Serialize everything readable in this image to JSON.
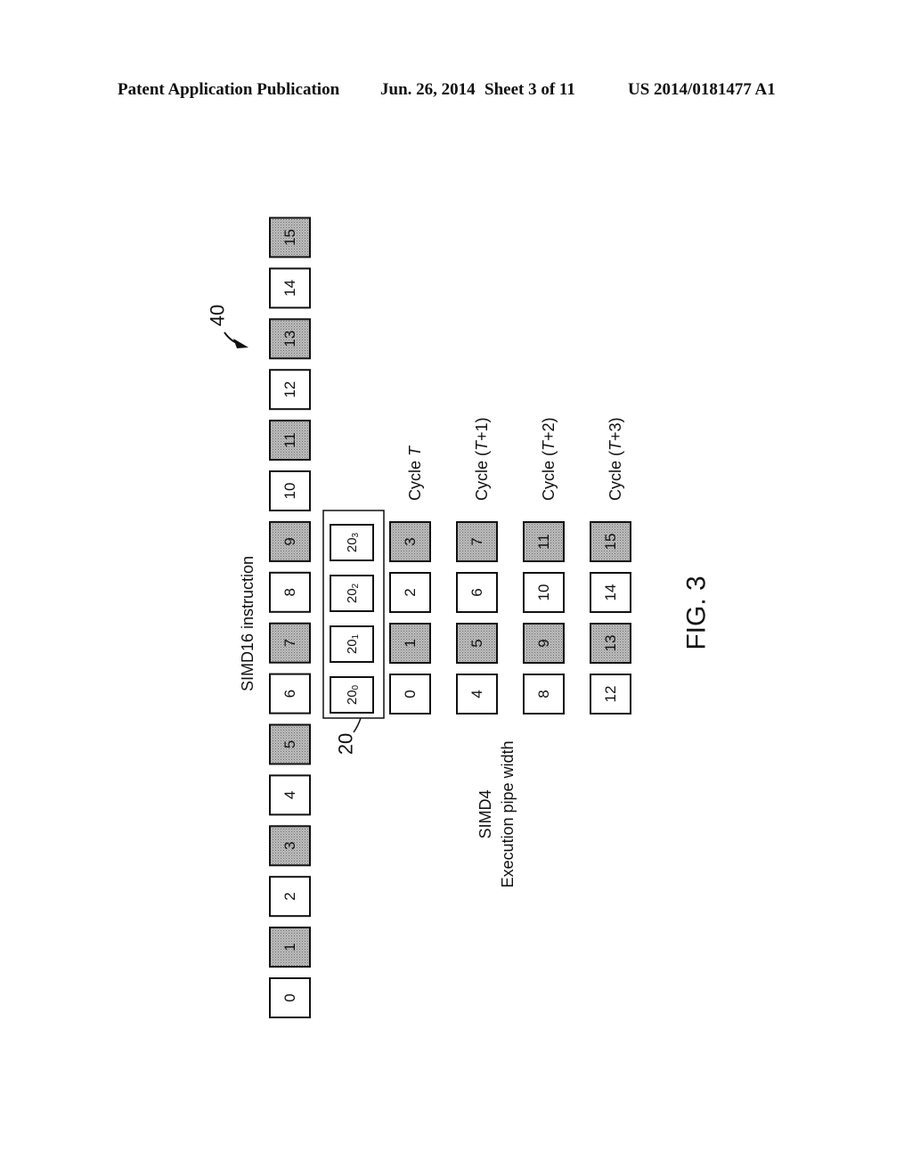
{
  "header": {
    "left": "Patent Application Publication",
    "date": "Jun. 26, 2014",
    "sheet": "Sheet 3 of 11",
    "number": "US 2014/0181477 A1"
  },
  "figure": {
    "caption": "FIG. 3",
    "simd16_label": "SIMD16 instruction",
    "ref_40": "40",
    "ref_20": "20",
    "simd4_label_line1": "SIMD4",
    "simd4_label_line2": "Execution pipe width",
    "simd16_lanes": [
      {
        "label": "0",
        "shaded": false
      },
      {
        "label": "1",
        "shaded": true
      },
      {
        "label": "2",
        "shaded": false
      },
      {
        "label": "3",
        "shaded": true
      },
      {
        "label": "4",
        "shaded": false
      },
      {
        "label": "5",
        "shaded": true
      },
      {
        "label": "6",
        "shaded": false
      },
      {
        "label": "7",
        "shaded": true
      },
      {
        "label": "8",
        "shaded": false
      },
      {
        "label": "9",
        "shaded": true
      },
      {
        "label": "10",
        "shaded": false
      },
      {
        "label": "11",
        "shaded": true
      },
      {
        "label": "12",
        "shaded": false
      },
      {
        "label": "13",
        "shaded": true
      },
      {
        "label": "14",
        "shaded": false
      },
      {
        "label": "15",
        "shaded": true
      }
    ],
    "pipes": [
      {
        "base": "20",
        "sub": "0"
      },
      {
        "base": "20",
        "sub": "1"
      },
      {
        "base": "20",
        "sub": "2"
      },
      {
        "base": "20",
        "sub": "3"
      }
    ],
    "cycles": [
      {
        "label_prefix": "Cycle ",
        "label_italic": "T",
        "label_suffix": "",
        "lanes": [
          {
            "label": "0",
            "shaded": false
          },
          {
            "label": "1",
            "shaded": true
          },
          {
            "label": "2",
            "shaded": false
          },
          {
            "label": "3",
            "shaded": true
          }
        ]
      },
      {
        "label_prefix": "Cycle (",
        "label_italic": "T",
        "label_suffix": "+1)",
        "lanes": [
          {
            "label": "4",
            "shaded": false
          },
          {
            "label": "5",
            "shaded": true
          },
          {
            "label": "6",
            "shaded": false
          },
          {
            "label": "7",
            "shaded": true
          }
        ]
      },
      {
        "label_prefix": "Cycle (",
        "label_italic": "T",
        "label_suffix": "+2)",
        "lanes": [
          {
            "label": "8",
            "shaded": false
          },
          {
            "label": "9",
            "shaded": true
          },
          {
            "label": "10",
            "shaded": false
          },
          {
            "label": "11",
            "shaded": true
          }
        ]
      },
      {
        "label_prefix": "Cycle (",
        "label_italic": "T",
        "label_suffix": "+3)",
        "lanes": [
          {
            "label": "12",
            "shaded": false
          },
          {
            "label": "13",
            "shaded": true
          },
          {
            "label": "14",
            "shaded": false
          },
          {
            "label": "15",
            "shaded": true
          }
        ]
      }
    ],
    "colors": {
      "shade": "#a9a9a9",
      "stroke": "#111111"
    }
  }
}
